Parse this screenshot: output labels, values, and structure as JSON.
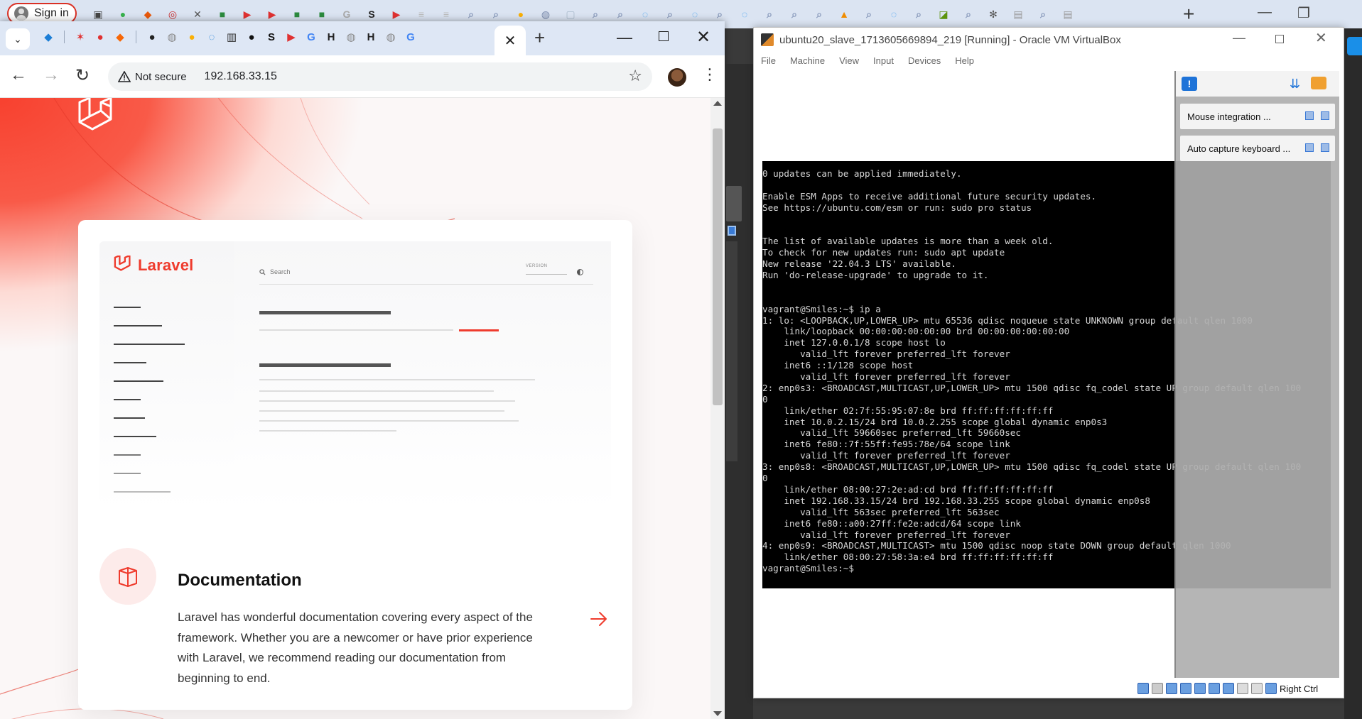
{
  "background_browser": {
    "sign_in_label": "Sign in",
    "new_tab_symbol": "+",
    "minimize_symbol": "—",
    "restore_symbol": "❐",
    "tab_icons": [
      {
        "icon": "tab-panel-icon",
        "color": "#444444",
        "glyph": "▣"
      },
      {
        "icon": "green-circle-icon",
        "color": "#37b24d",
        "glyph": "●"
      },
      {
        "icon": "red-diamond-icon",
        "color": "#e8590c",
        "glyph": "◆"
      },
      {
        "icon": "red-shape-icon",
        "color": "#c92a2a",
        "glyph": "◎"
      },
      {
        "icon": "close-icon",
        "color": "#555555",
        "glyph": "✕"
      },
      {
        "icon": "meet-icon",
        "color": "#2b8a3e",
        "glyph": "■"
      },
      {
        "icon": "youtube-icon",
        "color": "#e03131",
        "glyph": "▶"
      },
      {
        "icon": "youtube-icon",
        "color": "#e03131",
        "glyph": "▶"
      },
      {
        "icon": "meet-icon",
        "color": "#2b8a3e",
        "glyph": "■"
      },
      {
        "icon": "meet-icon",
        "color": "#2b8a3e",
        "glyph": "■"
      },
      {
        "icon": "google-icon",
        "color": "#aaaaaa",
        "glyph": "G"
      },
      {
        "icon": "s-icon",
        "color": "#222222",
        "glyph": "S"
      },
      {
        "icon": "youtube-icon",
        "color": "#e03131",
        "glyph": "▶"
      },
      {
        "icon": "doc-icon",
        "color": "#bbbbbb",
        "glyph": "≡"
      },
      {
        "icon": "doc-icon",
        "color": "#bbbbbb",
        "glyph": "≡"
      },
      {
        "icon": "search-icon",
        "color": "#8899bb",
        "glyph": "⌕"
      },
      {
        "icon": "search-icon",
        "color": "#8899bb",
        "glyph": "⌕"
      },
      {
        "icon": "yellow-icon",
        "color": "#fab005",
        "glyph": "●"
      },
      {
        "icon": "globe-icon",
        "color": "#7788aa",
        "glyph": "◍"
      },
      {
        "icon": "page-icon",
        "color": "#aabbcc",
        "glyph": "▢"
      },
      {
        "icon": "search-icon",
        "color": "#8899bb",
        "glyph": "⌕"
      },
      {
        "icon": "search-icon",
        "color": "#8899bb",
        "glyph": "⌕"
      },
      {
        "icon": "loading-icon",
        "color": "#339af0",
        "glyph": "◌"
      },
      {
        "icon": "search-icon",
        "color": "#8899bb",
        "glyph": "⌕"
      },
      {
        "icon": "loading-icon",
        "color": "#339af0",
        "glyph": "◌"
      },
      {
        "icon": "search-icon",
        "color": "#8899bb",
        "glyph": "⌕"
      },
      {
        "icon": "loading-icon",
        "color": "#339af0",
        "glyph": "◌"
      },
      {
        "icon": "search-icon",
        "color": "#8899bb",
        "glyph": "⌕"
      },
      {
        "icon": "search-icon",
        "color": "#8899bb",
        "glyph": "⌕"
      },
      {
        "icon": "search-icon",
        "color": "#8899bb",
        "glyph": "⌕"
      },
      {
        "icon": "orange-icon",
        "color": "#f08c00",
        "glyph": "▲"
      },
      {
        "icon": "search-icon",
        "color": "#8899bb",
        "glyph": "⌕"
      },
      {
        "icon": "loading-icon",
        "color": "#339af0",
        "glyph": "◌"
      },
      {
        "icon": "search-icon",
        "color": "#8899bb",
        "glyph": "⌕"
      },
      {
        "icon": "image-icon",
        "color": "#5c940d",
        "glyph": "◪"
      },
      {
        "icon": "search-icon",
        "color": "#8899bb",
        "glyph": "⌕"
      },
      {
        "icon": "spark-icon",
        "color": "#555555",
        "glyph": "✻"
      },
      {
        "icon": "calendar-icon",
        "color": "#999999",
        "glyph": "▤"
      },
      {
        "icon": "search-icon",
        "color": "#8899bb",
        "glyph": "⌕"
      },
      {
        "icon": "calendar-icon",
        "color": "#999999",
        "glyph": "▤"
      }
    ]
  },
  "chrome": {
    "tab_search_symbol": "⌄",
    "active_tab_close_symbol": "✕",
    "new_tab_symbol": "+",
    "minimize_symbol": "—",
    "close_symbol": "✕",
    "pinned_tabs": [
      {
        "icon": "blue-cube-icon",
        "color": "#1c7ed6",
        "glyph": "◆"
      },
      {
        "icon": "figure-icon",
        "color": "#e03131",
        "glyph": "✶"
      },
      {
        "icon": "redhat-icon",
        "color": "#e03131",
        "glyph": "●"
      },
      {
        "icon": "orange-cube-icon",
        "color": "#f76707",
        "glyph": "◆"
      },
      {
        "icon": "github-icon",
        "color": "#222222",
        "glyph": "●"
      },
      {
        "icon": "globe-icon",
        "color": "#888888",
        "glyph": "◍"
      },
      {
        "icon": "bulb-icon",
        "color": "#fab005",
        "glyph": "●"
      },
      {
        "icon": "loading-icon",
        "color": "#1c7ed6",
        "glyph": "◌"
      },
      {
        "icon": "chart-icon",
        "color": "#333333",
        "glyph": "▥"
      },
      {
        "icon": "medium-icon",
        "color": "#111111",
        "glyph": "●"
      },
      {
        "icon": "s-icon",
        "color": "#111111",
        "glyph": "S"
      },
      {
        "icon": "youtube-icon",
        "color": "#e03131",
        "glyph": "▶"
      },
      {
        "icon": "google-icon",
        "color": "#4285f4",
        "glyph": "G"
      },
      {
        "icon": "h-icon",
        "color": "#222222",
        "glyph": "H"
      },
      {
        "icon": "globe-icon",
        "color": "#888888",
        "glyph": "◍"
      },
      {
        "icon": "h-icon",
        "color": "#222222",
        "glyph": "H"
      },
      {
        "icon": "globe-icon",
        "color": "#888888",
        "glyph": "◍"
      },
      {
        "icon": "google-icon",
        "color": "#4285f4",
        "glyph": "G"
      }
    ],
    "back_symbol": "←",
    "forward_symbol": "→",
    "reload_symbol": "↻",
    "security_label": "Not secure",
    "url": "192.168.33.15",
    "bookmark_symbol": "☆",
    "menu_symbol": "⋮"
  },
  "laravel_page": {
    "mock_brand": "Laravel",
    "mock_search_placeholder": "Search",
    "mock_version_label": "VERSION",
    "documentation_title": "Documentation",
    "documentation_body": "Laravel has wonderful documentation covering every aspect of the framework. Whether you are a newcomer or have prior experience with Laravel, we recommend reading our documentation from beginning to end.",
    "accent_color": "#ef3b2d"
  },
  "virtualbox": {
    "window_title": "ubuntu20_slave_1713605669894_219 [Running] - Oracle VM VirtualBox",
    "minimize_symbol": "—",
    "close_symbol": "✕",
    "menu": [
      "File",
      "Machine",
      "View",
      "Input",
      "Devices",
      "Help"
    ],
    "terminal_lines": [
      "0 updates can be applied immediately.",
      "",
      "Enable ESM Apps to receive additional future security updates.",
      "See https://ubuntu.com/esm or run: sudo pro status",
      "",
      "",
      "The list of available updates is more than a week old.",
      "To check for new updates run: sudo apt update",
      "New release '22.04.3 LTS' available.",
      "Run 'do-release-upgrade' to upgrade to it.",
      "",
      "",
      "vagrant@Smiles:~$ ip a",
      "1: lo: <LOOPBACK,UP,LOWER_UP> mtu 65536 qdisc noqueue state UNKNOWN group default qlen 1000",
      "    link/loopback 00:00:00:00:00:00 brd 00:00:00:00:00:00",
      "    inet 127.0.0.1/8 scope host lo",
      "       valid_lft forever preferred_lft forever",
      "    inet6 ::1/128 scope host",
      "       valid_lft forever preferred_lft forever",
      "2: enp0s3: <BROADCAST,MULTICAST,UP,LOWER_UP> mtu 1500 qdisc fq_codel state UP group default qlen 100",
      "0",
      "    link/ether 02:7f:55:95:07:8e brd ff:ff:ff:ff:ff:ff",
      "    inet 10.0.2.15/24 brd 10.0.2.255 scope global dynamic enp0s3",
      "       valid_lft 59660sec preferred_lft 59660sec",
      "    inet6 fe80::7f:55ff:fe95:78e/64 scope link",
      "       valid_lft forever preferred_lft forever",
      "3: enp0s8: <BROADCAST,MULTICAST,UP,LOWER_UP> mtu 1500 qdisc fq_codel state UP group default qlen 100",
      "0",
      "    link/ether 08:00:27:2e:ad:cd brd ff:ff:ff:ff:ff:ff",
      "    inet 192.168.33.15/24 brd 192.168.33.255 scope global dynamic enp0s8",
      "       valid_lft 563sec preferred_lft 563sec",
      "    inet6 fe80::a00:27ff:fe2e:adcd/64 scope link",
      "       valid_lft forever preferred_lft forever",
      "4: enp0s9: <BROADCAST,MULTICAST> mtu 1500 qdisc noop state DOWN group default qlen 1000",
      "    link/ether 08:00:27:58:3a:e4 brd ff:ff:ff:ff:ff:ff",
      "vagrant@Smiles:~$ "
    ],
    "notifications": [
      {
        "label": "Mouse integration ..."
      },
      {
        "label": "Auto capture keyboard ..."
      }
    ],
    "host_key_label": "Right Ctrl"
  }
}
